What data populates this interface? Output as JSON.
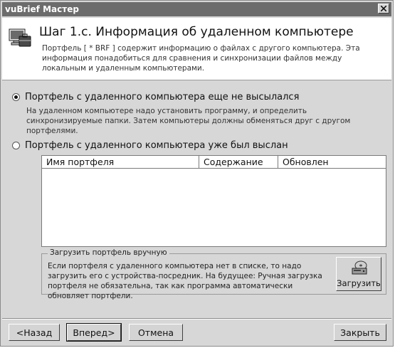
{
  "window": {
    "title": "vuBrief Мастер"
  },
  "header": {
    "title": "Шаг 1.c. Информация об удаленном компьютере",
    "description": "Портфель [ * BRF ] содержит информацию о файлах с другого компьютера. Эта информация понадобиться для сравнения и синхронизации файлов между локальным и удаленным компьютерами."
  },
  "options": [
    {
      "label": "Портфель с удаленного компьютера еще не высылался",
      "description": "На удаленном компьютере надо установить программу, и определить синхронизируемые папки. Затем компьютеры должны обменяться друг с другом портфелями.",
      "checked": true
    },
    {
      "label": "Портфель с удаленного компьютера уже был выслан",
      "description": "",
      "checked": false
    }
  ],
  "list": {
    "columns": [
      "Имя портфеля",
      "Содержание",
      "Обновлен"
    ],
    "rows": []
  },
  "manual_load": {
    "legend": "Загрузить портфель вручную",
    "text": "Если портфеля с удаленного компьютера нет в списке, то надо загрузить его с устройства-посредник. На будущее: Ручная загрузка портфеля не обязательна, так как программа автоматически обновляет портфели.",
    "button_label": "Загрузить",
    "button_icon": "disk-load-icon"
  },
  "footer": {
    "back_label": "<Назад",
    "next_label": "Вперед>",
    "cancel_label": "Отмена",
    "close_label": "Закрыть"
  }
}
